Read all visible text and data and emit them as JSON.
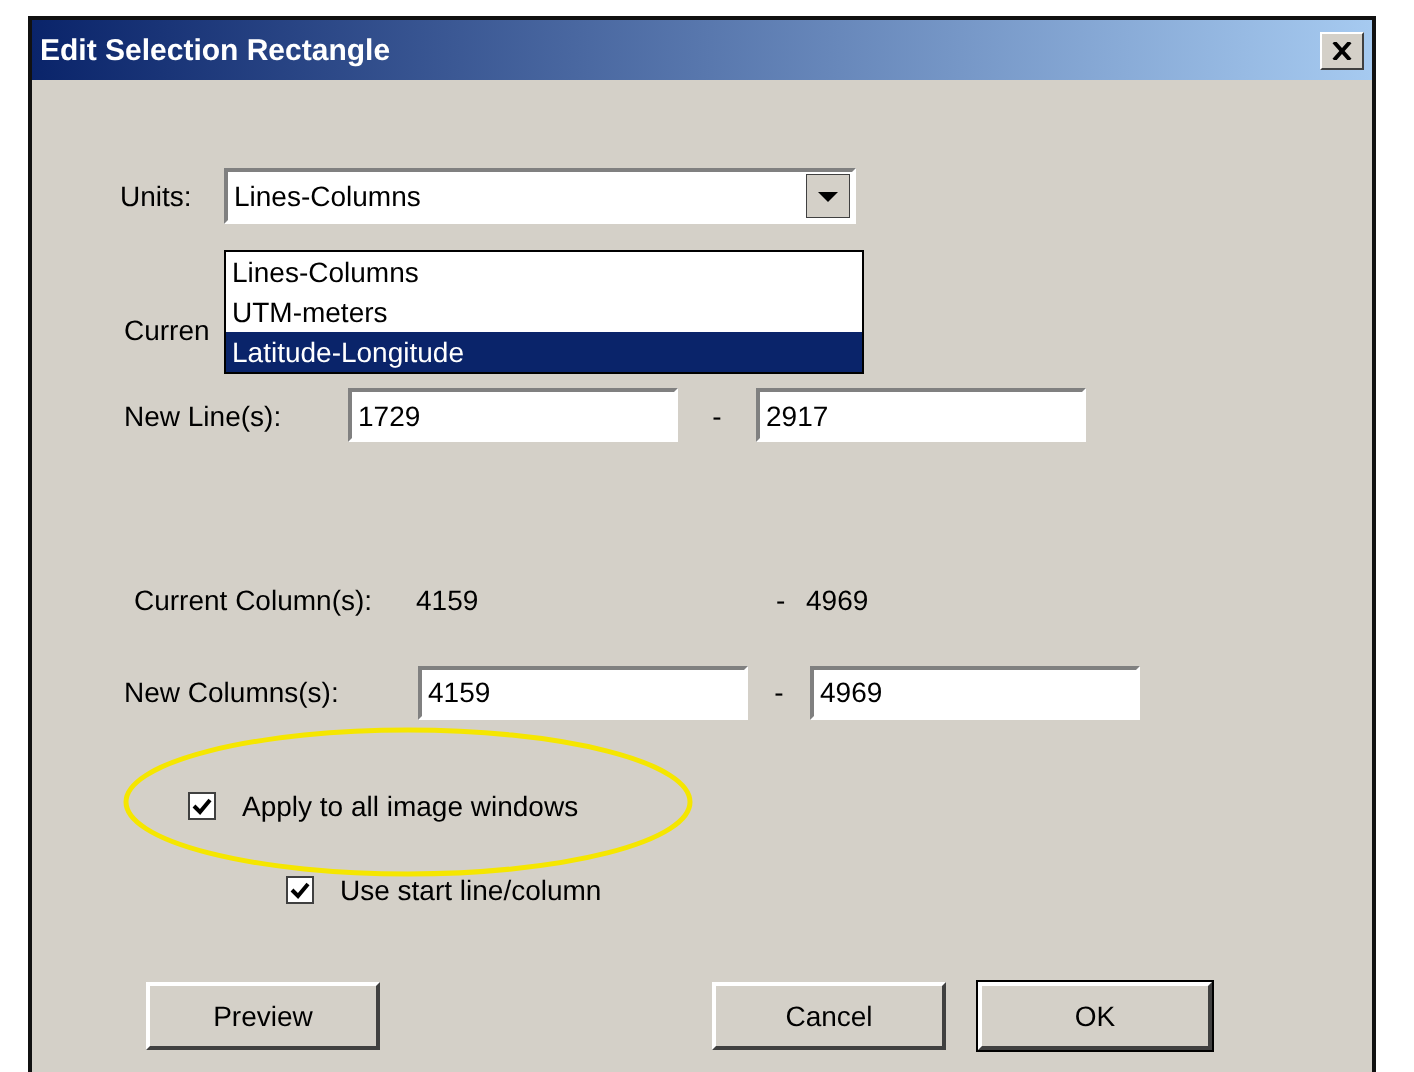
{
  "window": {
    "title": "Edit Selection Rectangle"
  },
  "units": {
    "label": "Units:",
    "value": "Lines-Columns",
    "expanded": true,
    "options": [
      {
        "label": "Lines-Columns",
        "highlighted": false
      },
      {
        "label": "UTM-meters",
        "highlighted": false
      },
      {
        "label": "Latitude-Longitude",
        "highlighted": true
      }
    ]
  },
  "current_lines": {
    "label": "Curren"
  },
  "new_lines": {
    "label": "New Line(s):",
    "from": "1729",
    "separator": "-",
    "to": "2917"
  },
  "current_columns": {
    "label": "Current Column(s):",
    "from": "4159",
    "separator": "-",
    "to": "4969"
  },
  "new_columns": {
    "label": "New Columns(s):",
    "from": "4159",
    "separator": "-",
    "to": "4969"
  },
  "checkboxes": [
    {
      "label": "Apply to all image windows",
      "checked": true
    },
    {
      "label": "Use start line/column",
      "checked": true
    }
  ],
  "buttons": [
    "Preview",
    "Cancel",
    "OK"
  ]
}
